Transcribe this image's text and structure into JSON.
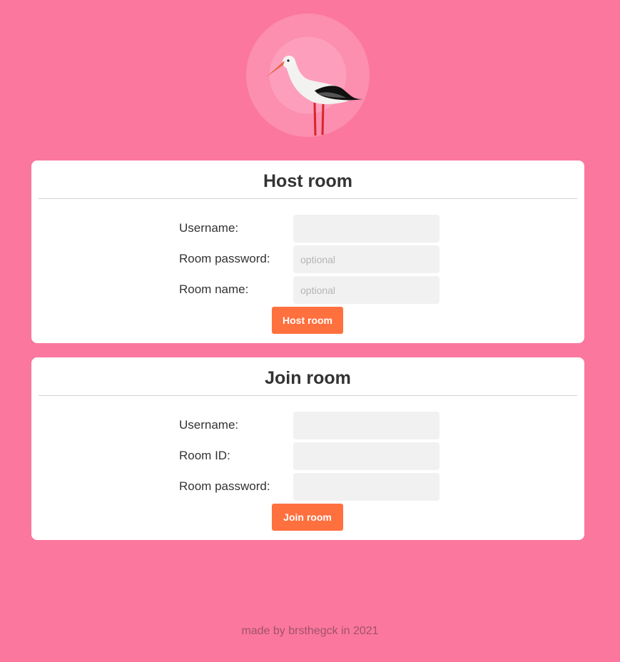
{
  "colors": {
    "background": "#fb779d",
    "card": "#ffffff",
    "accent_button": "#ff703f",
    "input_background": "#f1f1f1"
  },
  "logo": {
    "icon": "stork-icon"
  },
  "host": {
    "title": "Host room",
    "username_label": "Username:",
    "username_value": "",
    "password_label": "Room password:",
    "password_placeholder": "optional",
    "name_label": "Room name:",
    "name_placeholder": "optional",
    "button_label": "Host room"
  },
  "join": {
    "title": "Join room",
    "username_label": "Username:",
    "room_id_label": "Room ID:",
    "password_label": "Room password:",
    "button_label": "Join room"
  },
  "footer": {
    "text": "made by brsthegck in 2021"
  }
}
